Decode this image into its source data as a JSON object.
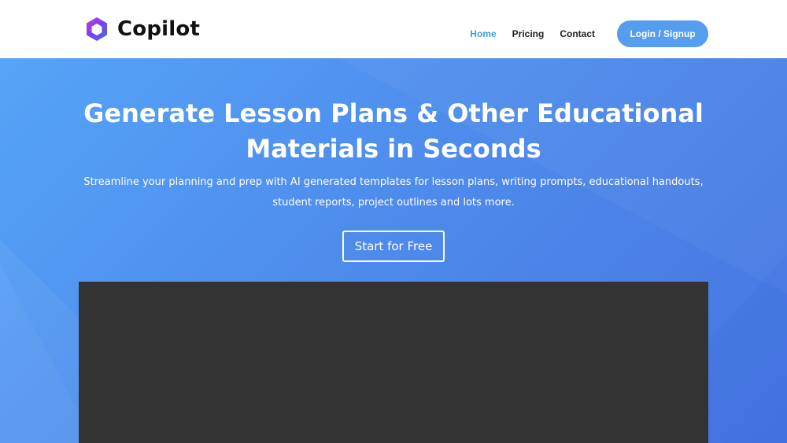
{
  "brand": {
    "name": "Copilot",
    "logo_icon": "hexagon-logo-icon",
    "logo_colors": [
      "#7b3ff2",
      "#c13ed6",
      "#3f6fe8"
    ]
  },
  "nav": {
    "items": [
      {
        "label": "Home",
        "active": true
      },
      {
        "label": "Pricing",
        "active": false
      },
      {
        "label": "Contact",
        "active": false
      }
    ],
    "login_label": "Login / Signup"
  },
  "hero": {
    "title": "Generate Lesson Plans & Other Educational Materials in Seconds",
    "subtitle": "Streamline your planning and prep with AI generated templates for lesson plans, writing prompts, educational handouts, student reports, project outlines and lots more.",
    "cta_label": "Start for Free"
  },
  "colors": {
    "accent": "#3b9ddb",
    "button": "#559dee",
    "hero_gradient_start": "#56a4f8",
    "hero_gradient_end": "#4674e0",
    "video_bg": "#333333"
  }
}
